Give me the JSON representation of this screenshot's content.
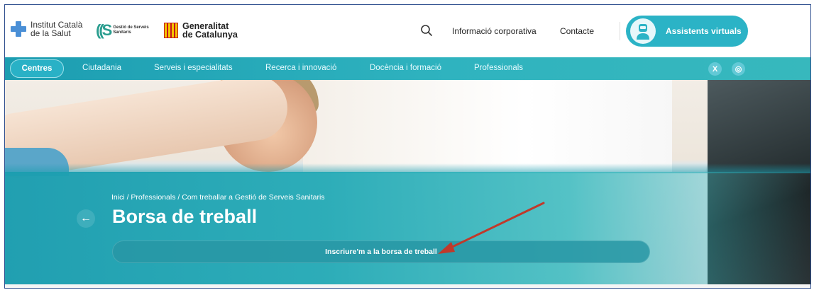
{
  "header": {
    "logo_ics_line1": "Institut Català",
    "logo_ics_line2": "de la Salut",
    "logo_gss_text": "Gestió de Serveis Sanitaris",
    "logo_gen_line1": "Generalitat",
    "logo_gen_line2": "de Catalunya",
    "link_corporate": "Informació corporativa",
    "link_contact": "Contacte",
    "assistant_button": "Assistents virtuals"
  },
  "nav": {
    "items": [
      "Centres",
      "Ciutadania",
      "Serveis i especialitats",
      "Recerca i innovació",
      "Docència i formació",
      "Professionals"
    ],
    "social": {
      "x": "X",
      "instagram": "◎"
    }
  },
  "hero": {
    "breadcrumb": "Inici / Professionals / Com treballar a Gestió de Serveis Sanitaris",
    "back_symbol": "←",
    "title": "Borsa de treball",
    "signup_button": "Inscriure'm a la borsa de treball"
  },
  "colors": {
    "accent": "#2bb3c6",
    "nav": "#1c9db1",
    "annotation_arrow": "#c0392b"
  },
  "icons": [
    "search-icon",
    "x-icon",
    "instagram-icon",
    "assistant-avatar-icon",
    "back-arrow-icon",
    "annotation-arrow"
  ]
}
